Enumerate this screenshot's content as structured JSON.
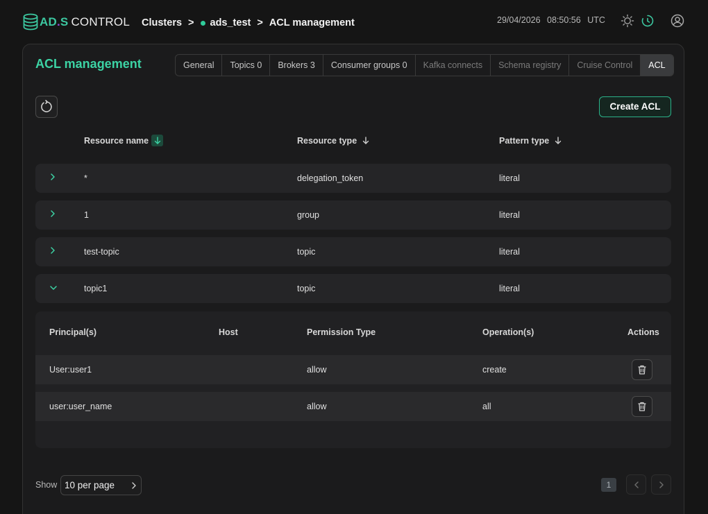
{
  "header": {
    "logo": {
      "ad": "AD",
      "dot": ".",
      "s": "S",
      "control": "CONTROL"
    },
    "breadcrumb": {
      "clusters": "Clusters",
      "sep1": ">",
      "cluster": "ads_test",
      "sep2": ">",
      "page": "ACL management"
    },
    "date": "29/04/2026",
    "time": "08:50:56",
    "timezone": "UTC"
  },
  "page_title": "ACL management",
  "tabs": [
    {
      "label": "General",
      "state": "normal"
    },
    {
      "label": "Topics 0",
      "state": "normal"
    },
    {
      "label": "Brokers 3",
      "state": "normal"
    },
    {
      "label": "Consumer groups 0",
      "state": "normal"
    },
    {
      "label": "Kafka connects",
      "state": "disabled"
    },
    {
      "label": "Schema registry",
      "state": "disabled"
    },
    {
      "label": "Cruise Control",
      "state": "disabled"
    },
    {
      "label": "ACL",
      "state": "active"
    }
  ],
  "toolbar": {
    "create_label": "Create ACL"
  },
  "columns": {
    "resource_name": "Resource name",
    "resource_type": "Resource type",
    "pattern_type": "Pattern type"
  },
  "rows": [
    {
      "name": "*",
      "type": "delegation_token",
      "pattern": "literal",
      "expanded": false
    },
    {
      "name": "1",
      "type": "group",
      "pattern": "literal",
      "expanded": false
    },
    {
      "name": "test-topic",
      "type": "topic",
      "pattern": "literal",
      "expanded": false
    },
    {
      "name": "topic1",
      "type": "topic",
      "pattern": "literal",
      "expanded": true
    }
  ],
  "detail": {
    "columns": {
      "principal": "Principal(s)",
      "host": "Host",
      "permission": "Permission Type",
      "operations": "Operation(s)",
      "actions": "Actions"
    },
    "rows": [
      {
        "principal": "User:user1",
        "host": "",
        "permission": "allow",
        "operations": "create"
      },
      {
        "principal": "user:user_name",
        "host": "",
        "permission": "allow",
        "operations": "all"
      }
    ]
  },
  "pagination": {
    "show_label": "Show",
    "page_size": "10 per page",
    "current_page": "1"
  },
  "colors": {
    "accent": "#3cd3a4",
    "background": "#151515",
    "panel": "#1b1b1c",
    "row": "#252527",
    "brand_purple": "#8f4bd6"
  }
}
